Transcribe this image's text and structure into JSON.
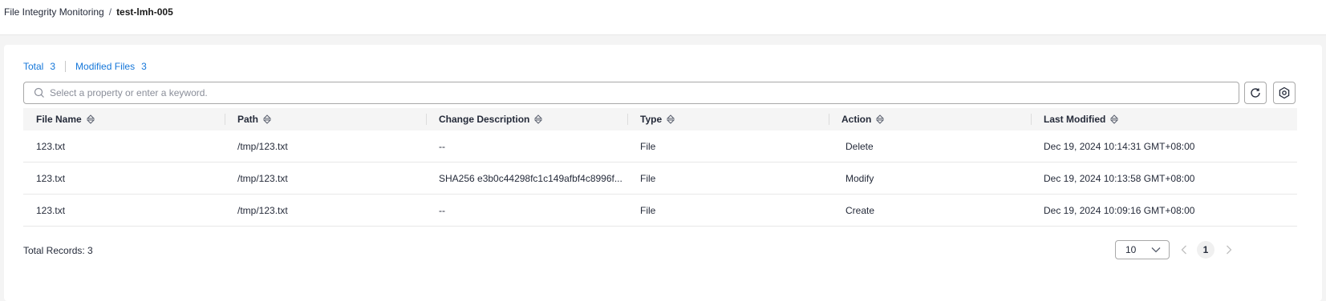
{
  "breadcrumb": {
    "parent": "File Integrity Monitoring",
    "separator": "/",
    "current": "test-lmh-005"
  },
  "tabs": [
    {
      "label": "Total",
      "count": "3"
    },
    {
      "label": "Modified Files",
      "count": "3"
    }
  ],
  "search": {
    "placeholder": "Select a property or enter a keyword."
  },
  "columns": [
    "File Name",
    "Path",
    "Change Description",
    "Type",
    "Action",
    "Last Modified"
  ],
  "rows": [
    [
      "123.txt",
      "/tmp/123.txt",
      "--",
      "File",
      "Delete",
      "Dec 19, 2024 10:14:31 GMT+08:00"
    ],
    [
      "123.txt",
      "/tmp/123.txt",
      "SHA256 e3b0c44298fc1c149afbf4c8996f...",
      "File",
      "Modify",
      "Dec 19, 2024 10:13:58 GMT+08:00"
    ],
    [
      "123.txt",
      "/tmp/123.txt",
      "--",
      "File",
      "Create",
      "Dec 19, 2024 10:09:16 GMT+08:00"
    ]
  ],
  "footer": {
    "total_records": "Total Records: 3"
  },
  "pagination": {
    "page_size": "10",
    "current_page": "1"
  },
  "colors": {
    "link": "#1476d9",
    "header_bg": "#f5f5f5",
    "page_bg": "#f4f4f4"
  }
}
